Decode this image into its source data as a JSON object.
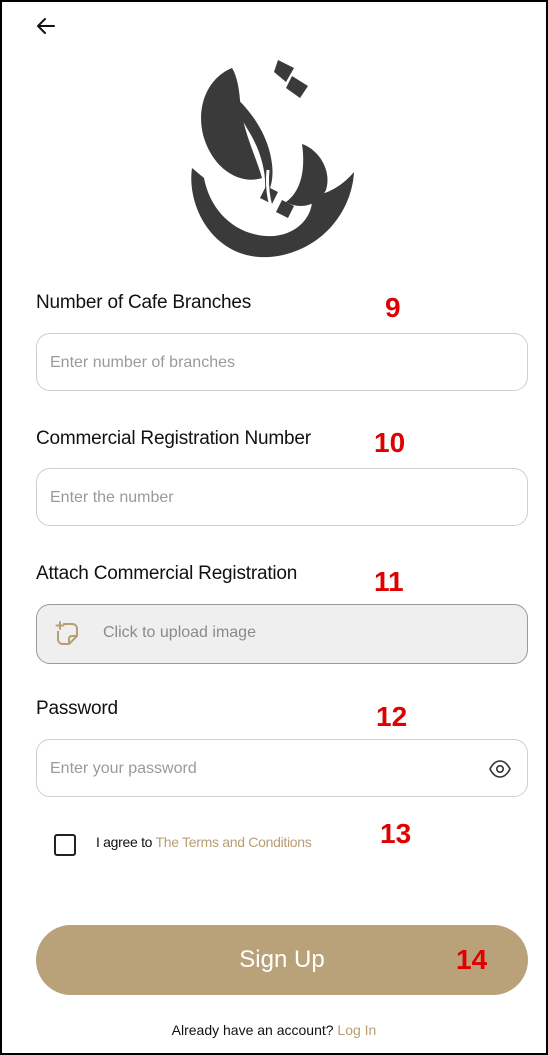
{
  "icons": {
    "back": "left-arrow-icon",
    "logo": "cafe-calligraphy-logo",
    "upload": "image-upload-icon",
    "eye": "eye-icon"
  },
  "form": {
    "branches": {
      "label": "Number of Cafe Branches",
      "placeholder": "Enter number of branches",
      "annotation": "9"
    },
    "cr_number": {
      "label": "Commercial Registration Number",
      "placeholder": "Enter the number",
      "annotation": "10"
    },
    "cr_attach": {
      "label": "Attach Commercial Registration",
      "upload_text": "Click to upload image",
      "annotation": "11"
    },
    "password": {
      "label": "Password",
      "placeholder": "Enter your password",
      "annotation": "12"
    },
    "terms": {
      "prefix": "I agree to",
      "link": "The Terms and Conditions",
      "annotation": "13"
    },
    "submit": {
      "label": "Sign Up",
      "annotation": "14"
    }
  },
  "footer": {
    "prompt": "Already have an account?",
    "login": "Log In"
  },
  "colors": {
    "accent": "#b9a27a",
    "link": "#b79e74",
    "annotation": "#e00000",
    "logo": "#3a3a3a"
  }
}
